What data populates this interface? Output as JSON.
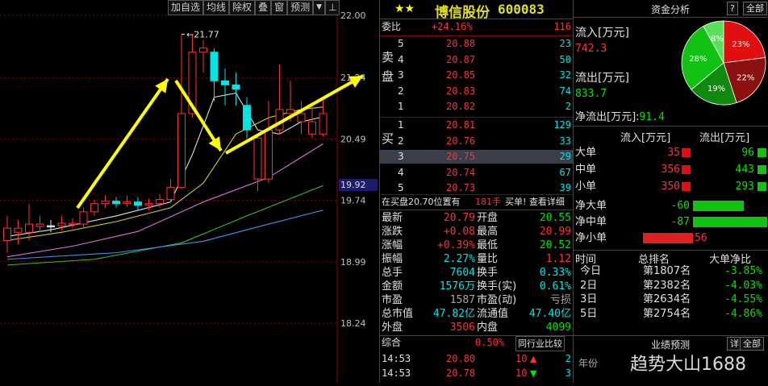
{
  "toolbar": {
    "items": [
      "加自选",
      "均线",
      "除权",
      "叠",
      "窗",
      "预测"
    ],
    "menu_icon": "dropdown-triangle-icon",
    "pin_icon": "pin-icon"
  },
  "chart": {
    "axis_labels": [
      "22.00",
      "21.77",
      "21.24",
      "20.49",
      "19.92",
      "19.74",
      "18.99",
      "18.24"
    ],
    "high_label": "21.77",
    "current_price": "19.92",
    "arrows": [
      "yellow-up-arrow",
      "yellow-down-arrow",
      "yellow-up-arrow"
    ],
    "candles": [
      {
        "o": 19.25,
        "c": 19.4,
        "h": 19.55,
        "l": 19.1,
        "dir": "up"
      },
      {
        "o": 19.4,
        "c": 19.35,
        "h": 19.5,
        "l": 19.2,
        "dir": "down"
      },
      {
        "o": 19.35,
        "c": 19.45,
        "h": 19.7,
        "l": 19.25,
        "dir": "up"
      },
      {
        "o": 19.45,
        "c": 19.42,
        "h": 19.55,
        "l": 19.35,
        "dir": "down"
      },
      {
        "o": 19.42,
        "c": 19.43,
        "h": 19.5,
        "l": 19.35,
        "dir": "doji"
      },
      {
        "o": 19.43,
        "c": 19.46,
        "h": 19.55,
        "l": 19.38,
        "dir": "up"
      },
      {
        "o": 19.46,
        "c": 19.45,
        "h": 19.52,
        "l": 19.4,
        "dir": "down"
      },
      {
        "o": 19.45,
        "c": 19.6,
        "h": 19.65,
        "l": 19.4,
        "dir": "up"
      },
      {
        "o": 19.6,
        "c": 19.7,
        "h": 19.75,
        "l": 19.55,
        "dir": "up"
      },
      {
        "o": 19.7,
        "c": 19.73,
        "h": 19.8,
        "l": 19.65,
        "dir": "up"
      },
      {
        "o": 19.73,
        "c": 19.7,
        "h": 19.78,
        "l": 19.65,
        "dir": "flatcyan"
      },
      {
        "o": 19.7,
        "c": 19.72,
        "h": 19.8,
        "l": 19.66,
        "dir": "up"
      },
      {
        "o": 19.72,
        "c": 19.68,
        "h": 19.78,
        "l": 19.62,
        "dir": "flatcyan"
      },
      {
        "o": 19.68,
        "c": 19.7,
        "h": 19.76,
        "l": 19.62,
        "dir": "up"
      },
      {
        "o": 19.7,
        "c": 19.75,
        "h": 19.82,
        "l": 19.65,
        "dir": "up"
      },
      {
        "o": 19.75,
        "c": 19.9,
        "h": 20.0,
        "l": 19.72,
        "dir": "up"
      },
      {
        "o": 19.9,
        "c": 20.8,
        "h": 21.77,
        "l": 19.88,
        "dir": "up"
      },
      {
        "o": 20.8,
        "c": 21.55,
        "h": 21.77,
        "l": 20.75,
        "dir": "up"
      },
      {
        "o": 21.55,
        "c": 21.6,
        "h": 21.7,
        "l": 21.3,
        "dir": "down"
      },
      {
        "o": 21.55,
        "c": 21.2,
        "h": 21.6,
        "l": 20.95,
        "dir": "flatcyan"
      },
      {
        "o": 21.2,
        "c": 21.15,
        "h": 21.35,
        "l": 20.9,
        "dir": "flatcyan"
      },
      {
        "o": 21.15,
        "c": 21.1,
        "h": 21.3,
        "l": 20.9,
        "dir": "flatcyan"
      },
      {
        "o": 20.9,
        "c": 20.6,
        "h": 21.0,
        "l": 20.5,
        "dir": "cyan"
      },
      {
        "o": 20.5,
        "c": 20.0,
        "h": 20.55,
        "l": 19.85,
        "dir": "down"
      },
      {
        "o": 20.0,
        "c": 20.6,
        "h": 20.95,
        "l": 19.95,
        "dir": "up"
      },
      {
        "o": 20.6,
        "c": 20.85,
        "h": 21.4,
        "l": 20.55,
        "dir": "up"
      },
      {
        "o": 20.85,
        "c": 20.8,
        "h": 21.2,
        "l": 20.7,
        "dir": "up"
      },
      {
        "o": 20.8,
        "c": 20.7,
        "h": 20.95,
        "l": 20.55,
        "dir": "up"
      },
      {
        "o": 20.7,
        "c": 20.55,
        "h": 20.9,
        "l": 20.5,
        "dir": "up"
      },
      {
        "o": 20.55,
        "c": 20.8,
        "h": 20.99,
        "l": 20.52,
        "dir": "up"
      }
    ]
  },
  "quote": {
    "stars": "★★",
    "name": "博信股份",
    "code": "600083",
    "webi_label": "委比",
    "webi_pct": "+24.16%",
    "webi_val": "116",
    "sell_label": "卖盘",
    "buy_label": "买盘",
    "sell": [
      {
        "lv": "5",
        "p": "20.88",
        "v": "23"
      },
      {
        "lv": "4",
        "p": "20.87",
        "v": "50"
      },
      {
        "lv": "3",
        "p": "20.85",
        "v": "32"
      },
      {
        "lv": "2",
        "p": "20.83",
        "v": "74"
      },
      {
        "lv": "1",
        "p": "20.82",
        "v": "2"
      }
    ],
    "buy": [
      {
        "lv": "1",
        "p": "20.81",
        "v": "129"
      },
      {
        "lv": "2",
        "p": "20.76",
        "v": "33"
      },
      {
        "lv": "3",
        "p": "20.75",
        "v": "29"
      },
      {
        "lv": "4",
        "p": "20.74",
        "v": "67"
      },
      {
        "lv": "5",
        "p": "20.73",
        "v": "39"
      }
    ],
    "notice": "在买盘20.70位置有",
    "notice_hands": "181手",
    "notice_right": "买单! 查看详细",
    "stats": [
      {
        "l1": "最新",
        "v1": "20.79",
        "c1": "red",
        "l2": "开盘",
        "v2": "20.55",
        "c2": "green"
      },
      {
        "l1": "涨跌",
        "v1": "+0.08",
        "c1": "red",
        "l2": "最高",
        "v2": "20.99",
        "c2": "red"
      },
      {
        "l1": "涨幅",
        "v1": "+0.39%",
        "c1": "red",
        "l2": "最低",
        "v2": "20.52",
        "c2": "green"
      },
      {
        "l1": "振幅",
        "v1": "2.27%",
        "c1": "cyan",
        "l2": "量比",
        "v2": "1.12",
        "c2": "red"
      },
      {
        "l1": "总手",
        "v1": "7604",
        "c1": "cyan",
        "l2": "换手",
        "v2": "0.33%",
        "c2": "cyan"
      },
      {
        "l1": "金额",
        "v1": "1576万",
        "c1": "cyan",
        "l2": "换手(实)",
        "v2": "0.61%",
        "c2": "cyan"
      },
      {
        "l1": "市盈",
        "v1": "1587",
        "c1": "gray",
        "l2": "市盈(动)",
        "v2": "亏损",
        "c2": "gray"
      },
      {
        "l1": "总市值",
        "v1": "47.82亿",
        "c1": "cyan",
        "l2": "流通值",
        "v2": "47.40亿",
        "c2": "cyan"
      },
      {
        "l1": "外盘",
        "v1": "3506",
        "c1": "red",
        "l2": "内盘",
        "v2": "4099",
        "c2": "green"
      }
    ],
    "composite_label": "综合",
    "composite_val": "0.50%",
    "compare_btn": "同行业比较",
    "ticks": [
      {
        "t": "14:53",
        "p": "20.80",
        "v": "10",
        "dir": "up",
        "n": "2"
      },
      {
        "t": "14:53",
        "p": "20.78",
        "v": "10",
        "dir": "down",
        "n": "3"
      }
    ]
  },
  "flow": {
    "title": "资金分析",
    "help": "?",
    "menu": "全部",
    "in_label": "流入[万元]",
    "in_val": "742.3",
    "out_label": "流出[万元]",
    "out_val": "833.7",
    "net_label": "净流出[万元]:",
    "net_val": "91.4",
    "pie": [
      {
        "label": "23%",
        "value": 23,
        "color": "#e01010"
      },
      {
        "label": "22%",
        "value": 22,
        "color": "#8b1010"
      },
      {
        "label": "19%",
        "value": 19,
        "color": "#0f8a0f"
      },
      {
        "label": "28%",
        "value": 28,
        "color": "#12c212"
      },
      {
        "label": "8%",
        "value": 8,
        "color": "#58e058"
      }
    ],
    "col_in": "流入[万元]",
    "col_out": "流出[万元]",
    "sizes": [
      {
        "label": "大单",
        "in": "35",
        "out": "96"
      },
      {
        "label": "中单",
        "in": "356",
        "out": "443"
      },
      {
        "label": "小单",
        "in": "350",
        "out": "293"
      }
    ],
    "nets": [
      {
        "label": "净大单",
        "val": "-60",
        "color": "green",
        "frac": 0.55
      },
      {
        "label": "净中单",
        "val": "-87",
        "color": "green",
        "frac": 0.8
      },
      {
        "label": "净小单",
        "val": "56",
        "color": "red",
        "frac": 0.52
      }
    ],
    "rank_headers": [
      "时间",
      "总排名",
      "大单净比"
    ],
    "ranks": [
      {
        "t": "今日",
        "r": "第1807名",
        "p": "-3.85%"
      },
      {
        "t": "2日",
        "r": "第2382名",
        "p": "-4.03%"
      },
      {
        "t": "3日",
        "r": "第2634名",
        "p": "-4.55%"
      },
      {
        "t": "5日",
        "r": "第2754名",
        "p": "-4.86%"
      }
    ],
    "forecast": "业绩预测",
    "detail": "详",
    "all": "全部",
    "year_label": "年份",
    "watermark": "趋势大山1688"
  }
}
